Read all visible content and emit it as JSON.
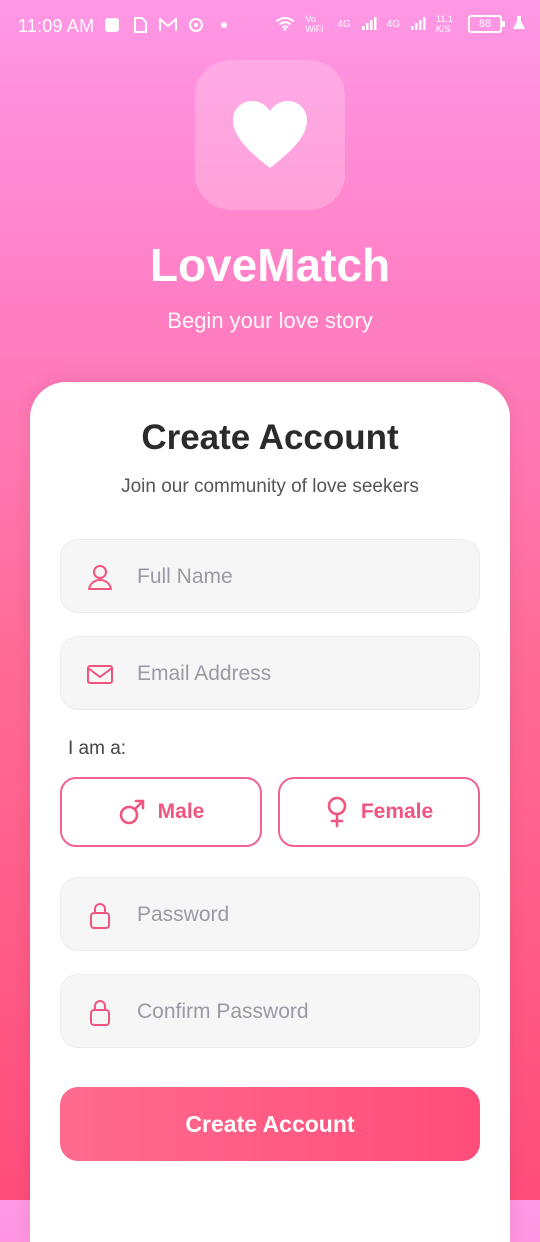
{
  "status_bar": {
    "time": "11:09 AM",
    "network_labels": [
      "Vo WiFi",
      "4G",
      "4G"
    ],
    "data_speed": "11.1 K/S",
    "battery": "88",
    "icons": [
      "notification-icon",
      "sim-icon",
      "gmail-icon",
      "threads-icon",
      "dot-icon",
      "wifi-icon",
      "signal-icon",
      "battery-icon"
    ]
  },
  "app": {
    "name": "LoveMatch",
    "tagline": "Begin your love story",
    "logo_icon": "heart-icon"
  },
  "form": {
    "title": "Create Account",
    "subtitle": "Join our community of love seekers",
    "full_name_placeholder": "Full Name",
    "email_placeholder": "Email Address",
    "gender_label": "I am a:",
    "gender_options": [
      "Male",
      "Female"
    ],
    "password_placeholder": "Password",
    "confirm_password_placeholder": "Confirm Password",
    "submit_label": "Create Account"
  },
  "colors": {
    "accent": "#f0557f",
    "gradient_top": "#ff98e6",
    "gradient_bottom": "#ff4d7a"
  }
}
